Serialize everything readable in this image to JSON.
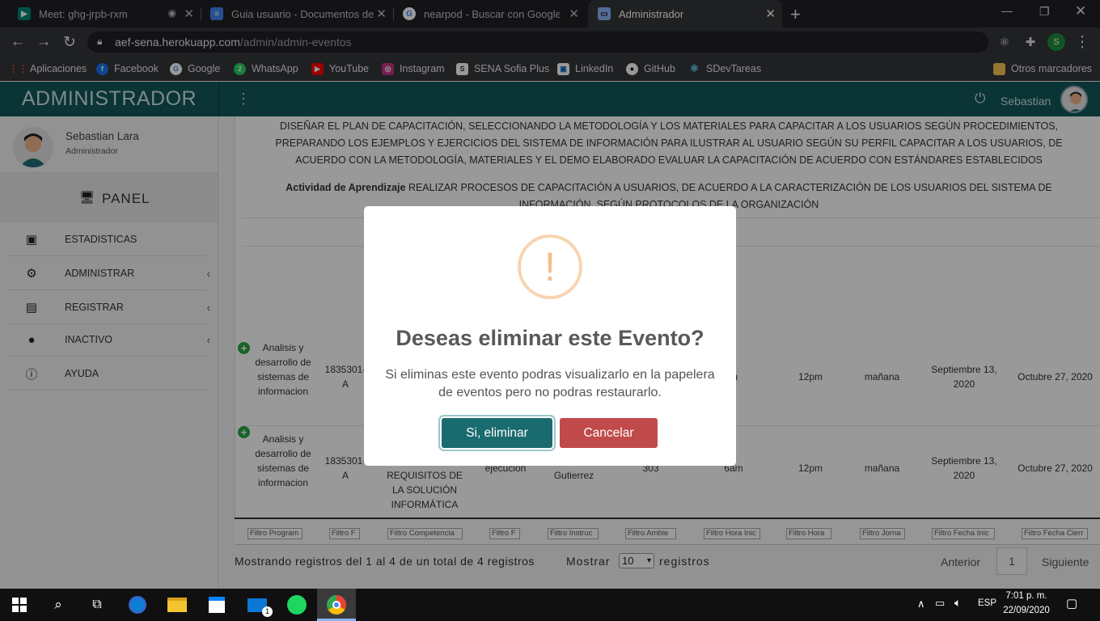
{
  "browser": {
    "tabs": [
      {
        "title": "Meet: ghg-jrpb-rxm",
        "icon": "meet-icon",
        "color": "#00897b"
      },
      {
        "title": "Guia usuario - Documentos de G",
        "icon": "docs-icon",
        "color": "#4285f4"
      },
      {
        "title": "nearpod - Buscar con Google",
        "icon": "google-icon",
        "color": "#ffffff"
      },
      {
        "title": "Administrador",
        "icon": "page-icon",
        "color": "#8ab4f8"
      }
    ],
    "url_host": "aef-sena.herokuapp.com",
    "url_path": "/admin/admin-eventos",
    "profile_initial": "S",
    "bookmarks": [
      "Aplicaciones",
      "Facebook",
      "Google",
      "WhatsApp",
      "YouTube",
      "Instagram",
      "SENA Sofia Plus",
      "LinkedIn",
      "GitHub",
      "SDevTareas"
    ],
    "other_bookmarks": "Otros marcadores"
  },
  "app": {
    "brand": "ADMINISTRADOR",
    "header_user": "Sebastian",
    "user_name": "Sebastian Lara",
    "user_role": "Administrador",
    "panel_label": "PANEL",
    "menu": [
      {
        "label": "ESTADISTICAS",
        "icon": "passport-icon",
        "has_submenu": false
      },
      {
        "label": "ADMINISTRAR",
        "icon": "users-cog-icon",
        "has_submenu": true
      },
      {
        "label": "REGISTRAR",
        "icon": "id-card-icon",
        "has_submenu": true
      },
      {
        "label": "INACTIVO",
        "icon": "moon-dot-icon",
        "has_submenu": true
      },
      {
        "label": "AYUDA",
        "icon": "info-icon",
        "has_submenu": false
      }
    ],
    "accent": "#12575b"
  },
  "content": {
    "description_text": "DISEÑAR EL PLAN DE CAPACITACIÓN, SELECCIONANDO LA METODOLOGÍA Y LOS MATERIALES PARA CAPACITAR A LOS USUARIOS SEGÚN PROCEDIMIENTOS, PREPARANDO LOS EJEMPLOS Y EJERCICIOS DEL SISTEMA DE INFORMACIÓN PARA ILUSTRAR AL USUARIO SEGÚN SU PERFIL CAPACITAR A LOS USUARIOS, DE ACUERDO CON LA METODOLOGÍA, MATERIALES Y EL DEMO ELABORADO EVALUAR LA CAPACITACIÓN DE ACUERDO CON ESTÁNDARES ESTABLECIDOS",
    "activity_label": "Actividad de Aprendizaje",
    "activity_text": "REALIZAR PROCESOS DE CAPACITACIÓN A USUARIOS, DE ACUERDO A LA CARACTERIZACIÓN DE LOS USUARIOS DEL SISTEMA DE INFORMACIÓN, SEGÚN PROTOCOLOS DE LA ORGANIZACIÓN",
    "rows": [
      {
        "programa": "Analisis y desarrollo de sistemas de informacion",
        "ficha": "1835301-A",
        "competencia": "",
        "fase": "",
        "instructor": "",
        "ambiente": "",
        "hora_inicio": "m",
        "hora_fin": "12pm",
        "jornada": "mañana",
        "fecha_inicio": "Septiembre 13, 2020",
        "fecha_cierre": "Octubre 27, 2020"
      },
      {
        "programa": "Analisis y desarrollo de sistemas de informacion",
        "ficha": "1835301-A",
        "competencia": "REQUISITOS DE LA SOLUCIÓN INFORMÁTICA",
        "fase": "ejecución",
        "instructor": "Gutierrez",
        "ambiente": "303",
        "hora_inicio": "6am",
        "hora_fin": "12pm",
        "jornada": "mañana",
        "fecha_inicio": "Septiembre 13, 2020",
        "fecha_cierre": "Octubre 27, 2020"
      }
    ],
    "filters": [
      "Filtro Program",
      "Filtro F",
      "Filtro Competencia",
      "Filtro F",
      "Filtro Instruc",
      "Filtro Ambie",
      "Filtro Hora Inic",
      "Filtro Hora",
      "Filtro Jorna",
      "Filtro Fecha Inic",
      "Filtro Fecha Cierr"
    ],
    "showing_text": "Mostrando registros del 1 al 4 de un total de 4 registros",
    "show_label": "Mostrar",
    "show_value": "10",
    "records_label": "registros",
    "prev_label": "Anterior",
    "current_page": "1",
    "next_label": "Siguiente"
  },
  "modal": {
    "icon": "!",
    "title": "Deseas eliminar este Evento?",
    "text": "Si eliminas este evento podras visualizarlo en la papelera de eventos pero no podras restaurarlo.",
    "confirm_label": "Si, eliminar",
    "cancel_label": "Cancelar",
    "confirm_color": "#1a6b6f",
    "cancel_color": "#c14a4a"
  },
  "taskbar": {
    "language": "ESP",
    "time": "7:01 p. m.",
    "date": "22/09/2020",
    "mail_badge": "1"
  }
}
